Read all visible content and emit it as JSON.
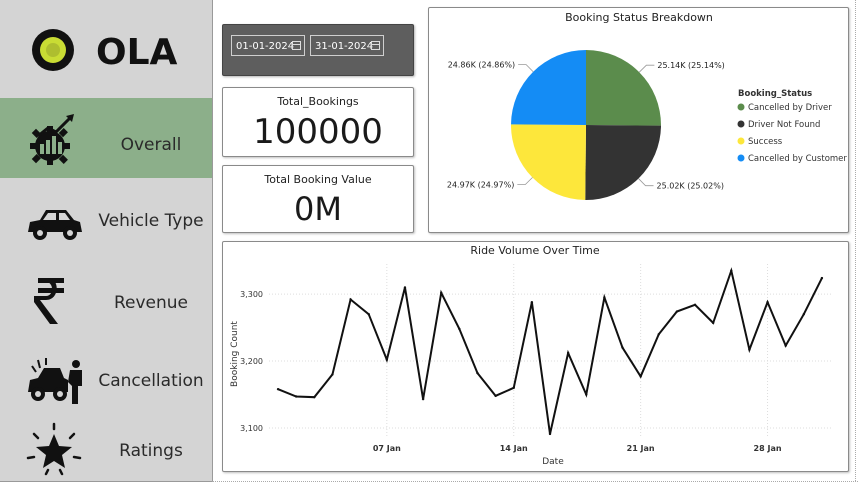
{
  "brand": {
    "name": "OLA"
  },
  "nav": {
    "items": [
      {
        "label": "Overall",
        "icon": "gear-growth-chart-icon",
        "active": true
      },
      {
        "label": "Vehicle Type",
        "icon": "car-icon",
        "active": false
      },
      {
        "label": "Revenue",
        "icon": "rupee-icon",
        "active": false
      },
      {
        "label": "Cancellation",
        "icon": "broken-car-icon",
        "active": false
      },
      {
        "label": "Ratings",
        "icon": "star-burst-icon",
        "active": false
      }
    ]
  },
  "filters": {
    "start_date": "01-01-2024",
    "end_date": "31-01-2024"
  },
  "cards": {
    "total_bookings": {
      "title": "Total_Bookings",
      "value": "100000"
    },
    "total_booking_value": {
      "title": "Total Booking Value",
      "value": "0M"
    }
  },
  "colors": {
    "accent": "#8caf8a",
    "cancelled_by_driver": "#5b8c4c",
    "driver_not_found": "#333333",
    "success": "#fde73b",
    "cancelled_by_customer": "#148cf5"
  },
  "chart_data": [
    {
      "type": "pie",
      "title": "Booking Status Breakdown",
      "legend_title": "Booking_Status",
      "legend_position": "right",
      "slices": [
        {
          "name": "Cancelled by Driver",
          "value": 25140,
          "label": "25.14K (25.14%)",
          "color": "#5b8c4c"
        },
        {
          "name": "Driver Not Found",
          "value": 25020,
          "label": "25.02K (25.02%)",
          "color": "#333333"
        },
        {
          "name": "Success",
          "value": 24970,
          "label": "24.97K (24.97%)",
          "color": "#fde73b"
        },
        {
          "name": "Cancelled by Customer",
          "value": 24860,
          "label": "24.86K (24.86%)",
          "color": "#148cf5"
        }
      ]
    },
    {
      "type": "line",
      "title": "Ride Volume Over Time",
      "xlabel": "Date",
      "ylabel": "Booking Count",
      "x_start_day": 1,
      "x_tick_labels": [
        "07 Jan",
        "14 Jan",
        "21 Jan",
        "28 Jan"
      ],
      "x_tick_days": [
        7,
        14,
        21,
        28
      ],
      "y_ticks": [
        3100,
        3200,
        3300
      ],
      "y_tick_labels": [
        "3,100",
        "3,200",
        "3,300"
      ],
      "ylim": [
        3085,
        3345
      ],
      "xlim": [
        0.5,
        31.5
      ],
      "grid": true,
      "values": [
        3158,
        3147,
        3146,
        3180,
        3292,
        3270,
        3202,
        3310,
        3143,
        3302,
        3248,
        3182,
        3148,
        3160,
        3288,
        3091,
        3212,
        3150,
        3295,
        3220,
        3177,
        3240,
        3274,
        3284,
        3257,
        3335,
        3217,
        3288,
        3223,
        3270,
        3324
      ]
    }
  ]
}
